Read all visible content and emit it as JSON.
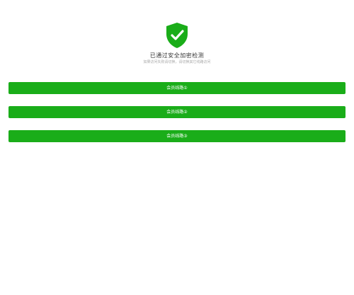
{
  "colors": {
    "accent": "#1aad19",
    "title": "#333333",
    "subtitle": "#a9a9a9"
  },
  "header": {
    "icon": "shield-check-icon",
    "title": "已通过安全加密检测",
    "subtitle": "如果访问失败请切换，请切换其它线路访问"
  },
  "lines": [
    {
      "label": "会员线路①"
    },
    {
      "label": "会员线路②"
    },
    {
      "label": "会员线路③"
    }
  ]
}
